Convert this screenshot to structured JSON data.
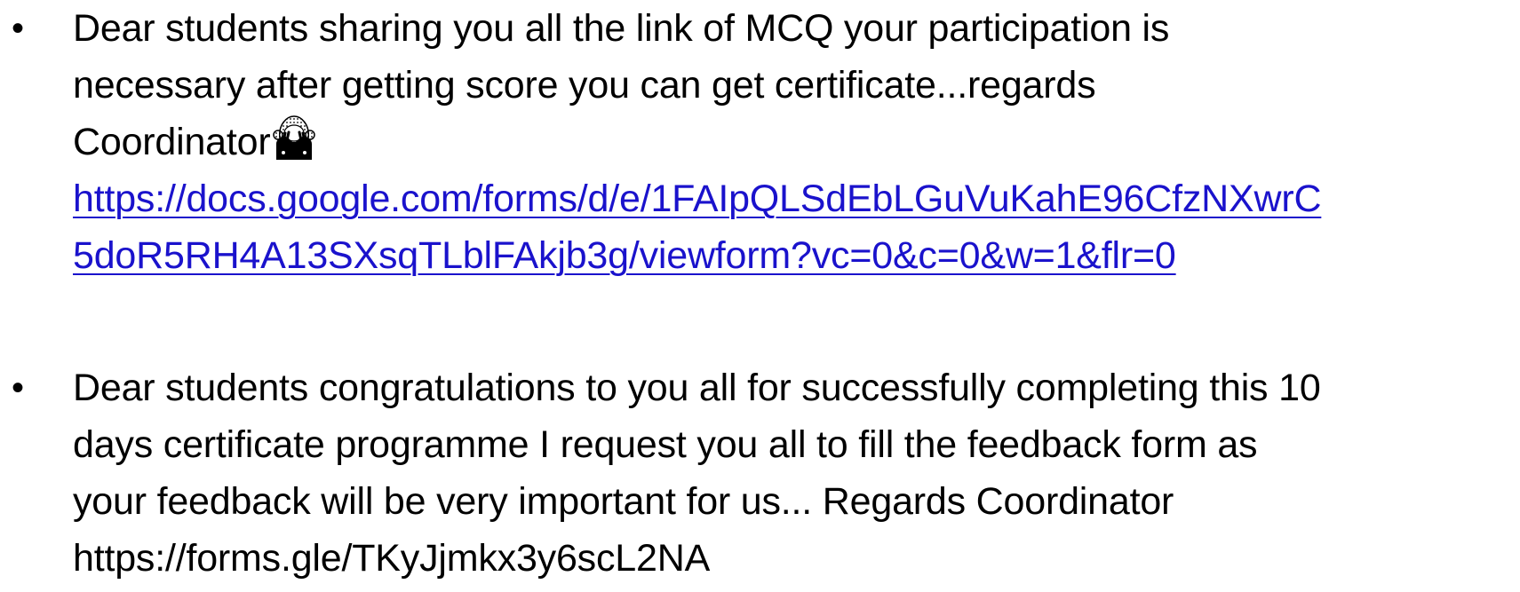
{
  "slide": {
    "items": [
      {
        "bullet": "•",
        "lines": [
          "Dear students sharing you all the link of MCQ your participation is",
          "necessary after getting score you can get certificate...regards",
          "Coordinator"
        ],
        "emoji": "see-no-evil-monkey-icon",
        "link_lines": [
          "https://docs.google.com/forms/d/e/1FAIpQLSdEbLGuVuKahE96CfzNXwrC",
          "5doR5RH4A13SXsqTLblFAkjb3g/viewform?vc=0&c=0&w=1&flr=0"
        ],
        "link_color": "#1a12cc"
      },
      {
        "bullet": "•",
        "lines": [
          "Dear students congratulations to you all for successfully completing this 10",
          "days certificate programme I request you all to fill the feedback form as",
          "your feedback will be very important for  us... Regards Coordinator"
        ],
        "url": "https://forms.gle/TKyJjmkx3y6scL2NA"
      }
    ]
  }
}
